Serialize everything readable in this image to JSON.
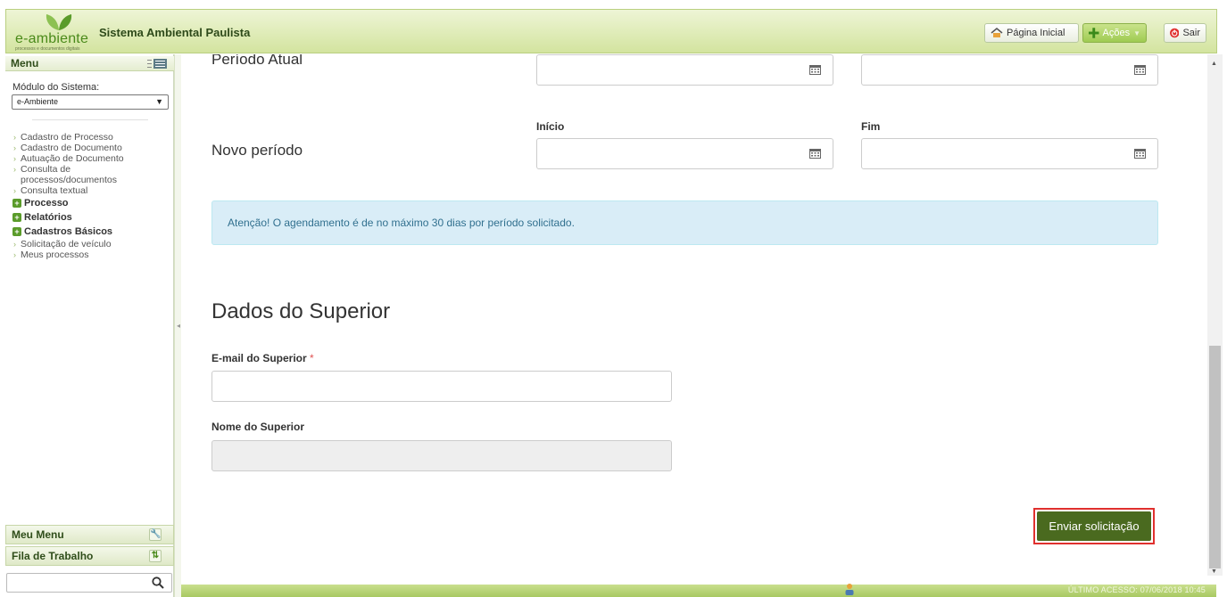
{
  "header": {
    "logo_text": "e-ambiente",
    "logo_subtext": "processos e documentos digitais",
    "app_title": "Sistema Ambiental Paulista",
    "home_label": "Página Inicial",
    "acoes_label": "Ações",
    "sair_label": "Sair"
  },
  "sidebar": {
    "menu_label": "Menu",
    "module_label": "Módulo do Sistema:",
    "module_value": "e-Ambiente",
    "items": [
      "Cadastro de Processo",
      "Cadastro de Documento",
      "Autuação de Documento",
      "Consulta de processos/documentos",
      "Consulta textual"
    ],
    "groups": [
      "Processo",
      "Relatórios",
      "Cadastros Básicos"
    ],
    "items_after": [
      "Solicitação de veículo",
      "Meus processos"
    ],
    "meu_menu_label": "Meu Menu",
    "fila_label": "Fila de Trabalho",
    "search_placeholder": ""
  },
  "form": {
    "periodo_atual_label": "Período Atual",
    "novo_periodo_label": "Novo período",
    "inicio_label": "Início",
    "fim_label": "Fim",
    "alert_text": "Atenção! O agendamento é de no máximo 30 dias por período solicitado.",
    "section_title": "Dados do Superior",
    "email_label": "E-mail do Superior",
    "required_mark": "*",
    "email_value": "",
    "nome_label": "Nome do Superior",
    "nome_value": "",
    "submit_label": "Enviar solicitação"
  },
  "footer": {
    "last_access": "ÚLTIMO ACESSO: 07/06/2018 10:45"
  },
  "colors": {
    "brand_green": "#4a6a1f",
    "header_green": "#d3e49f",
    "alert_bg": "#d9edf7",
    "highlight_red": "#e0302e"
  }
}
